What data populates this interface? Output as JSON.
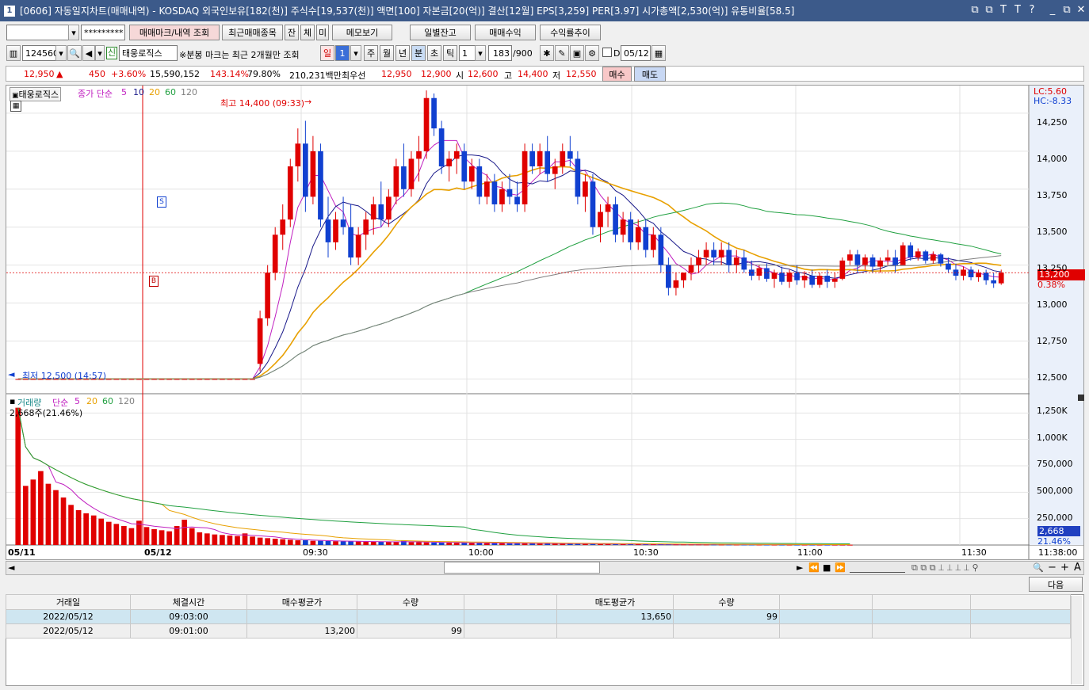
{
  "window": {
    "icon_text": "1",
    "title": "[0606] 자동일지차트(매매내역) - KOSDAQ 외국인보유[182(천)] 주식수[19,537(천)] 액면[100] 자본금[20(억)] 결산[12월] EPS[3,259] PER[3.97] 시가총액[2,530(억)] 유통비율[58.5]",
    "controls": [
      "⧉",
      "⧉",
      "T",
      "T",
      "?",
      "_",
      "⧉",
      "✕"
    ]
  },
  "toolbar1": {
    "account_value": "",
    "password_mask": "*********",
    "buttons": [
      "매매마크/내역 조회",
      "최근매매종목",
      "잔",
      "체",
      "미",
      "메모보기",
      "일별잔고",
      "매매수익",
      "수익률추이"
    ]
  },
  "toolbar2": {
    "code": "124560",
    "badge": "신",
    "name": "태웅로직스",
    "note": "※분봉 마크는 최근 2개월만 조회",
    "period_tabs": [
      "일",
      "주",
      "월",
      "년",
      "분",
      "초",
      "틱"
    ],
    "period_count": "1",
    "tick_value": "1",
    "count": "183",
    "max_count": "/900",
    "date_flag": "D",
    "date": "05/12"
  },
  "quote": {
    "price": "12,950",
    "arrow": "▲",
    "change": "450",
    "change_pct": "+3.60%",
    "volume": "15,590,152",
    "vol_ratio": "143.14%",
    "turnover": "79.80%",
    "amount": "210,231백만",
    "best_label": "최우선",
    "best_ask": "12,950",
    "best_bid": "12,900",
    "open_label": "시",
    "open": "12,600",
    "high_label": "고",
    "high": "14,400",
    "low_label": "저",
    "low": "12,550",
    "buy_label": "매수",
    "sell_label": "매도"
  },
  "colors": {
    "up": "#e00000",
    "down": "#1040d0",
    "ma5": "#c020c0",
    "ma10": "#1a1a8a",
    "ma20": "#e8a000",
    "ma60": "#20a040",
    "ma120": "#808080"
  },
  "price_panel": {
    "legend_name": "태웅로직스",
    "legend_type": "종가 단순",
    "legend_periods": [
      "5",
      "10",
      "20",
      "60",
      "120"
    ],
    "high_annot": "최고 14,400 (09:33)",
    "low_annot": "최저 12,500 (14:57)",
    "lc": "LC:5.60",
    "hc": "HC:-8.33",
    "current_label": "13,200",
    "current_pct": "0.38%",
    "axis_ticks": [
      "14,250",
      "14,000",
      "13,750",
      "13,500",
      "13,250",
      "13,000",
      "12,750",
      "12,500"
    ],
    "buy_mark": "B",
    "sell_mark": "S"
  },
  "volume_panel": {
    "legend_name": "거래량",
    "legend_type": "단순",
    "legend_periods": [
      "5",
      "20",
      "60",
      "120"
    ],
    "last_volume": "2,668주(21.46%)",
    "axis_ticks": [
      "1,250K",
      "1,000K",
      "750,000",
      "500,000",
      "250,000"
    ],
    "current_label": "2,668",
    "current_pct": "21.46%"
  },
  "chart_data": {
    "type": "candlestick",
    "y_range": [
      12450,
      14380
    ],
    "volume_range": [
      0,
      1350000
    ],
    "x_labels": [
      "05/11",
      "05/12",
      "09:30",
      "10:00",
      "10:30",
      "11:00",
      "11:30"
    ],
    "time_label": "11:38:00",
    "candles": [
      [
        12500,
        12500,
        12500,
        12500
      ],
      [
        12500,
        12500,
        12500,
        12500
      ],
      [
        12500,
        12500,
        12500,
        12500
      ],
      [
        12500,
        12500,
        12500,
        12500
      ],
      [
        12500,
        12500,
        12500,
        12500
      ],
      [
        12500,
        12500,
        12500,
        12500
      ],
      [
        12500,
        12500,
        12500,
        12500
      ],
      [
        12500,
        12500,
        12500,
        12500
      ],
      [
        12500,
        12500,
        12500,
        12500
      ],
      [
        12500,
        12500,
        12500,
        12500
      ],
      [
        12500,
        12500,
        12500,
        12500
      ],
      [
        12500,
        12500,
        12500,
        12500
      ],
      [
        12500,
        12500,
        12500,
        12500
      ],
      [
        12500,
        12500,
        12500,
        12500
      ],
      [
        12500,
        12500,
        12500,
        12500
      ],
      [
        12500,
        12500,
        12500,
        12500
      ],
      [
        12500,
        12500,
        12500,
        12500
      ],
      [
        12500,
        12500,
        12500,
        12500
      ],
      [
        12500,
        12500,
        12500,
        12500
      ],
      [
        12500,
        12500,
        12500,
        12500
      ],
      [
        12500,
        12500,
        12500,
        12500
      ],
      [
        12500,
        12500,
        12500,
        12500
      ],
      [
        12500,
        12500,
        12500,
        12500
      ],
      [
        12500,
        12500,
        12500,
        12500
      ],
      [
        12500,
        12500,
        12500,
        12500
      ],
      [
        12500,
        12500,
        12500,
        12500
      ],
      [
        12500,
        12500,
        12500,
        12500
      ],
      [
        12500,
        12500,
        12500,
        12500
      ],
      [
        12500,
        12500,
        12500,
        12500
      ],
      [
        12500,
        12500,
        12500,
        12500
      ],
      [
        12500,
        12500,
        12500,
        12500
      ],
      [
        12500,
        12500,
        12500,
        12500
      ],
      [
        12600,
        12950,
        12550,
        12900
      ],
      [
        12900,
        13250,
        12850,
        13200
      ],
      [
        13200,
        13500,
        13150,
        13450
      ],
      [
        13450,
        13650,
        13350,
        13550
      ],
      [
        13550,
        13950,
        13500,
        13900
      ],
      [
        13900,
        14150,
        13800,
        14050
      ],
      [
        14050,
        14200,
        13600,
        13700
      ],
      [
        13700,
        14100,
        13650,
        14000
      ],
      [
        14000,
        14050,
        13500,
        13550
      ],
      [
        13550,
        13700,
        13300,
        13400
      ],
      [
        13400,
        13600,
        13350,
        13550
      ],
      [
        13550,
        13700,
        13450,
        13500
      ],
      [
        13500,
        13650,
        13250,
        13300
      ],
      [
        13300,
        13500,
        13250,
        13450
      ],
      [
        13450,
        13600,
        13350,
        13550
      ],
      [
        13550,
        13700,
        13450,
        13650
      ],
      [
        13650,
        13800,
        13500,
        13550
      ],
      [
        13550,
        13750,
        13500,
        13700
      ],
      [
        13700,
        13950,
        13650,
        13900
      ],
      [
        13900,
        14050,
        13700,
        13750
      ],
      [
        13750,
        14000,
        13700,
        13950
      ],
      [
        13950,
        14100,
        13800,
        14000
      ],
      [
        14000,
        14400,
        13950,
        14350
      ],
      [
        14350,
        14380,
        14100,
        14150
      ],
      [
        14150,
        14200,
        13850,
        13900
      ],
      [
        13900,
        14000,
        13800,
        13950
      ],
      [
        13950,
        14050,
        13850,
        14000
      ],
      [
        14000,
        14050,
        13750,
        13800
      ],
      [
        13800,
        13950,
        13750,
        13900
      ],
      [
        13900,
        13950,
        13650,
        13700
      ],
      [
        13700,
        13850,
        13650,
        13800
      ],
      [
        13800,
        13850,
        13600,
        13650
      ],
      [
        13650,
        13800,
        13600,
        13750
      ],
      [
        13750,
        13850,
        13650,
        13700
      ],
      [
        13700,
        13800,
        13600,
        13650
      ],
      [
        13650,
        14050,
        13600,
        14000
      ],
      [
        14000,
        14050,
        13850,
        13900
      ],
      [
        13900,
        14050,
        13850,
        14000
      ],
      [
        14000,
        14100,
        13800,
        13850
      ],
      [
        13850,
        13950,
        13750,
        13900
      ],
      [
        13900,
        14050,
        13850,
        14000
      ],
      [
        14000,
        14100,
        13900,
        13950
      ],
      [
        13950,
        14000,
        13650,
        13700
      ],
      [
        13700,
        13850,
        13600,
        13800
      ],
      [
        13800,
        13850,
        13450,
        13500
      ],
      [
        13500,
        13650,
        13400,
        13600
      ],
      [
        13600,
        13700,
        13500,
        13650
      ],
      [
        13650,
        13700,
        13400,
        13450
      ],
      [
        13450,
        13600,
        13400,
        13550
      ],
      [
        13550,
        13600,
        13350,
        13400
      ],
      [
        13400,
        13550,
        13350,
        13500
      ],
      [
        13500,
        13550,
        13300,
        13350
      ],
      [
        13350,
        13500,
        13300,
        13450
      ],
      [
        13450,
        13500,
        13200,
        13250
      ],
      [
        13250,
        13300,
        13050,
        13100
      ],
      [
        13100,
        13200,
        13050,
        13150
      ],
      [
        13150,
        13200,
        13100,
        13200
      ],
      [
        13200,
        13300,
        13150,
        13250
      ],
      [
        13250,
        13350,
        13200,
        13300
      ],
      [
        13300,
        13400,
        13250,
        13350
      ],
      [
        13350,
        13400,
        13250,
        13300
      ],
      [
        13300,
        13400,
        13250,
        13350
      ],
      [
        13350,
        13400,
        13200,
        13250
      ],
      [
        13250,
        13350,
        13200,
        13300
      ],
      [
        13300,
        13350,
        13200,
        13220
      ],
      [
        13220,
        13280,
        13150,
        13180
      ],
      [
        13180,
        13250,
        13150,
        13230
      ],
      [
        13230,
        13260,
        13140,
        13160
      ],
      [
        13160,
        13220,
        13100,
        13200
      ],
      [
        13200,
        13240,
        13120,
        13140
      ],
      [
        13140,
        13220,
        13100,
        13200
      ],
      [
        13200,
        13250,
        13120,
        13150
      ],
      [
        13150,
        13210,
        13100,
        13180
      ],
      [
        13180,
        13220,
        13100,
        13120
      ],
      [
        13120,
        13200,
        13100,
        13180
      ],
      [
        13180,
        13220,
        13100,
        13140
      ],
      [
        13140,
        13200,
        13100,
        13160
      ],
      [
        13160,
        13300,
        13150,
        13280
      ],
      [
        13280,
        13350,
        13250,
        13320
      ],
      [
        13320,
        13350,
        13200,
        13250
      ],
      [
        13250,
        13320,
        13220,
        13300
      ],
      [
        13300,
        13320,
        13200,
        13240
      ],
      [
        13240,
        13300,
        13200,
        13280
      ],
      [
        13280,
        13350,
        13250,
        13300
      ],
      [
        13300,
        13350,
        13200,
        13250
      ],
      [
        13250,
        13400,
        13250,
        13380
      ],
      [
        13380,
        13400,
        13280,
        13300
      ],
      [
        13300,
        13360,
        13280,
        13340
      ],
      [
        13340,
        13350,
        13260,
        13280
      ],
      [
        13280,
        13340,
        13260,
        13320
      ],
      [
        13320,
        13330,
        13240,
        13260
      ],
      [
        13260,
        13300,
        13200,
        13220
      ],
      [
        13220,
        13260,
        13150,
        13180
      ],
      [
        13180,
        13240,
        13150,
        13220
      ],
      [
        13220,
        13240,
        13150,
        13170
      ],
      [
        13170,
        13220,
        13140,
        13200
      ],
      [
        13200,
        13220,
        13120,
        13150
      ],
      [
        13150,
        13200,
        13100,
        13130
      ],
      [
        13130,
        13220,
        13120,
        13200
      ]
    ],
    "volumes": [
      1300000,
      560000,
      620000,
      700000,
      580000,
      520000,
      450000,
      380000,
      330000,
      300000,
      280000,
      250000,
      220000,
      200000,
      180000,
      160000,
      230000,
      170000,
      150000,
      140000,
      130000,
      180000,
      240000,
      160000,
      120000,
      110000,
      100000,
      95000,
      90000,
      85000,
      110000,
      80000,
      70000,
      65000,
      60000,
      55000,
      50000,
      45000,
      45000,
      40000,
      40000,
      38000,
      36000,
      35000,
      34000,
      33000,
      32000,
      31000,
      30000,
      29000,
      28000,
      40000,
      27000,
      26000,
      25000,
      24000,
      23000,
      22000,
      21000,
      20000,
      20000,
      19000,
      18000,
      18000,
      17000,
      16000,
      16000,
      15000,
      15000,
      14000,
      14000,
      13000,
      13000,
      12000,
      12000,
      11000,
      11000,
      10000,
      10000,
      9000,
      9000,
      8000,
      8000,
      7500,
      7000,
      7000,
      6500,
      6000,
      6000,
      5500,
      5500,
      5000,
      5000,
      4800,
      4500,
      4300,
      4100,
      4000,
      3800,
      3600,
      3500,
      3400,
      3300,
      3200,
      3100,
      3000,
      2900,
      2800,
      2700,
      2700,
      2668
    ]
  },
  "nav": {
    "next_label": "다음"
  },
  "trades": {
    "headers": [
      "거래일",
      "체결시간",
      "매수평균가",
      "수량",
      "",
      "매도평균가",
      "수량",
      "",
      "",
      ""
    ],
    "rows": [
      [
        "2022/05/12",
        "09:03:00",
        "",
        "",
        "",
        "13,650",
        "99",
        "",
        "",
        ""
      ],
      [
        "2022/05/12",
        "09:01:00",
        "13,200",
        "99",
        "",
        "",
        "",
        "",
        "",
        ""
      ]
    ]
  }
}
